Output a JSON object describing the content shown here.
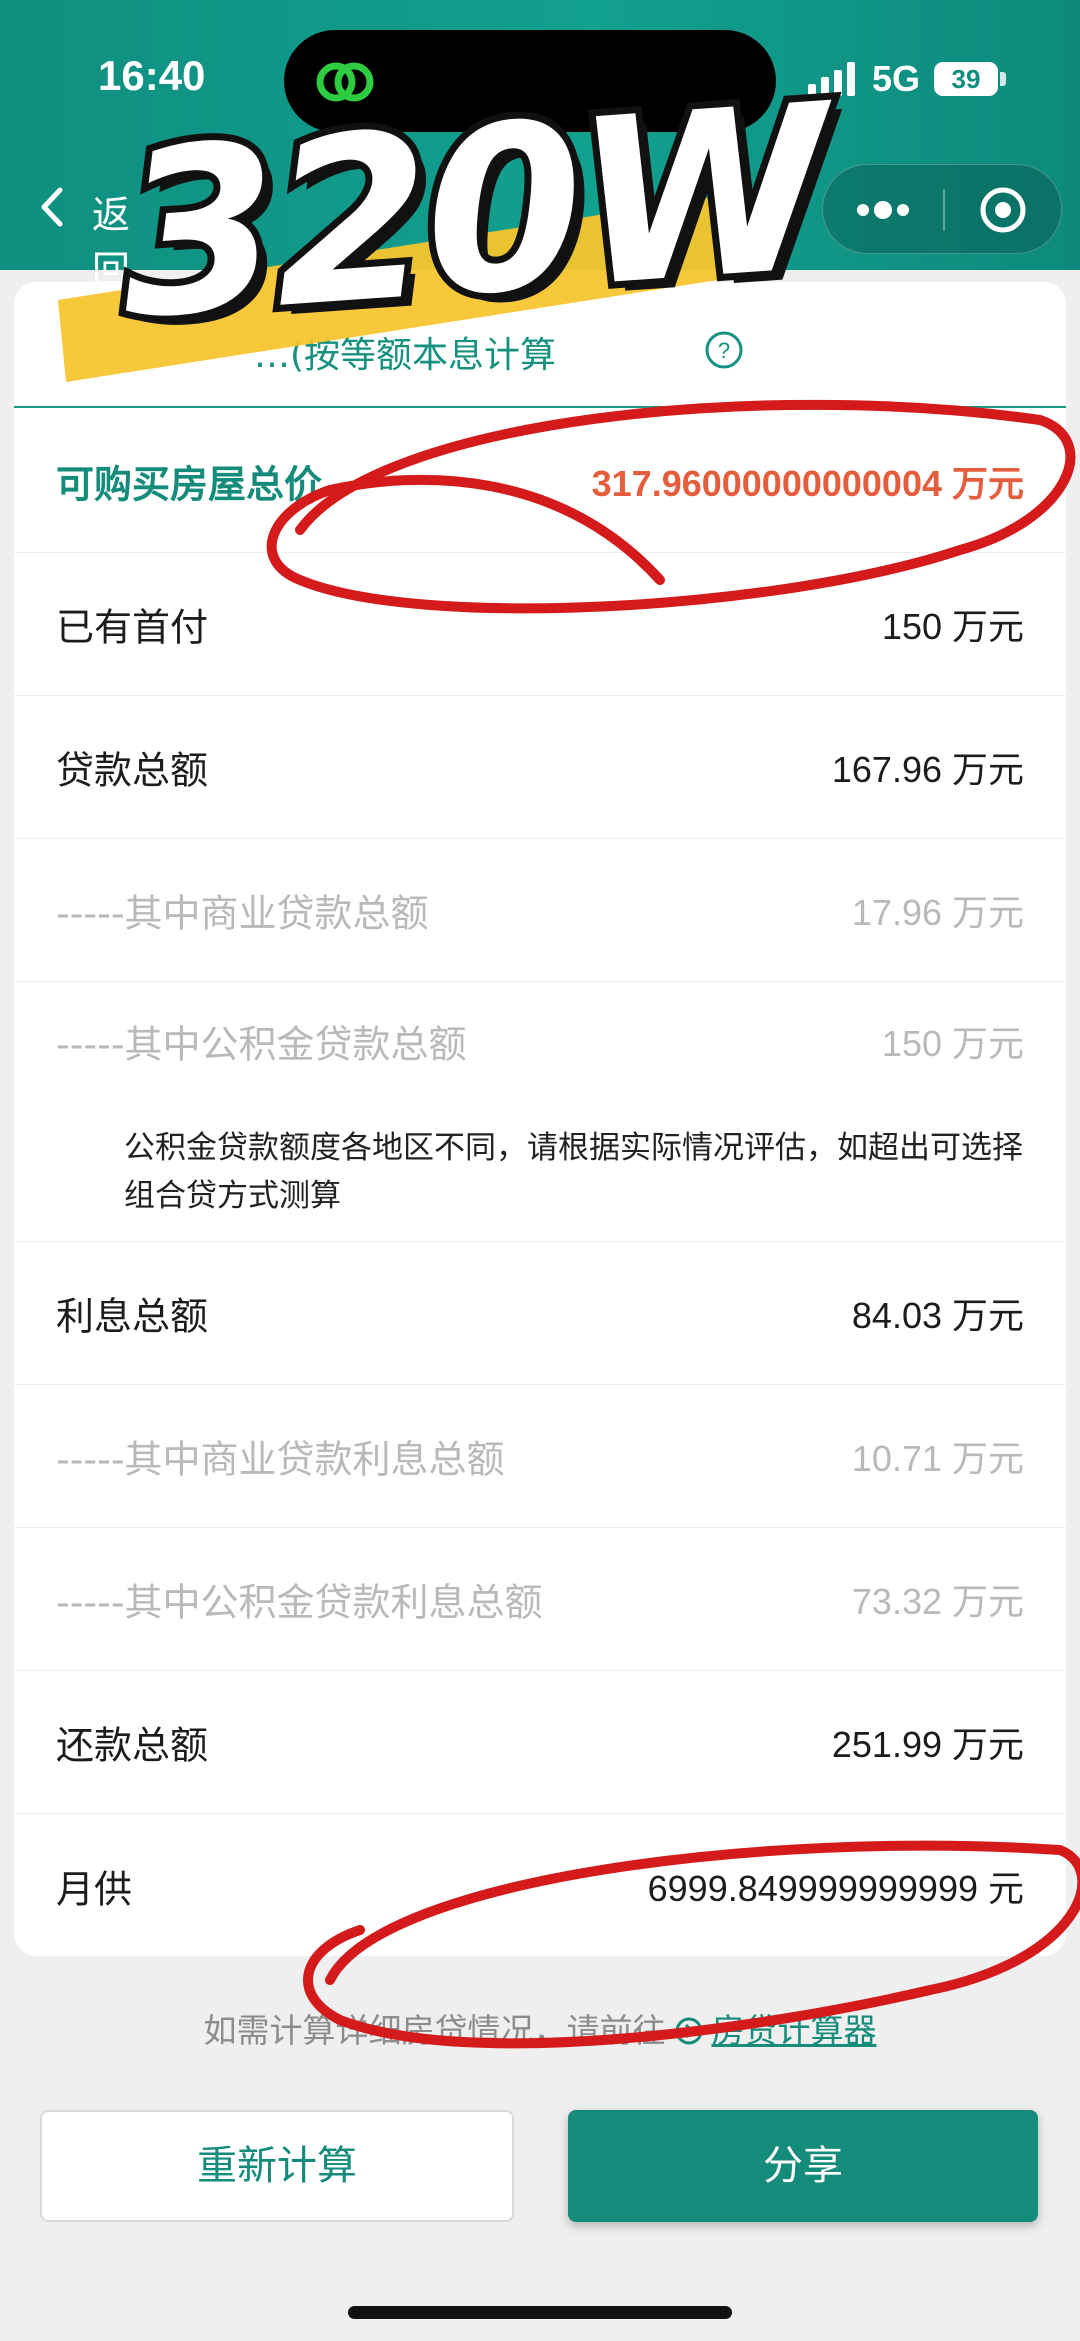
{
  "status_bar": {
    "time": "16:40",
    "network": "5G",
    "battery": "39"
  },
  "nav": {
    "back_label": "返回"
  },
  "subtitle": "…(按等额本息计算",
  "rows": [
    {
      "label": "可购买房屋总价",
      "value": "317.96000000000004 万元",
      "style": "highlight"
    },
    {
      "label": "已有首付",
      "value": "150 万元",
      "style": "normal"
    },
    {
      "label": "贷款总额",
      "value": "167.96 万元",
      "style": "normal"
    },
    {
      "label": "-----其中商业贷款总额",
      "value": "17.96 万元",
      "style": "sub"
    },
    {
      "label": "-----其中公积金贷款总额",
      "value": "150 万元",
      "style": "sub"
    },
    {
      "label": "利息总额",
      "value": "84.03 万元",
      "style": "normal"
    },
    {
      "label": "-----其中商业贷款利息总额",
      "value": "10.71 万元",
      "style": "sub"
    },
    {
      "label": "-----其中公积金贷款利息总额",
      "value": "73.32 万元",
      "style": "sub"
    },
    {
      "label": "还款总额",
      "value": "251.99 万元",
      "style": "normal"
    },
    {
      "label": "月供",
      "value": "6999.849999999999 元",
      "style": "normal"
    }
  ],
  "note": "公积金贷款额度各地区不同，请根据实际情况评估，如超出可选择组合贷方式测算",
  "footer": {
    "hint": "如需计算详细房贷情况，请前往",
    "link": "房贷计算器"
  },
  "buttons": {
    "recalc": "重新计算",
    "share": "分享"
  },
  "overlay": {
    "big_text": "320W",
    "annotation_color": "#d41a1a",
    "marker_color": "#f7c52e"
  },
  "colors": {
    "theme": "#148b7b",
    "highlight_value": "#e45d3d"
  }
}
